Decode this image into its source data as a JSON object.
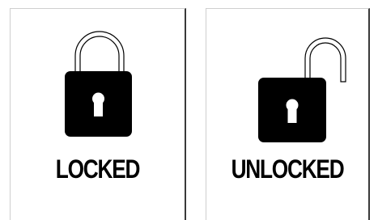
{
  "panels": [
    {
      "label": "LOCKED",
      "lock_icon": "locked-padlock-icon"
    },
    {
      "label": "UNLOCKED",
      "lock_icon": "unlocked-padlock-icon"
    }
  ]
}
